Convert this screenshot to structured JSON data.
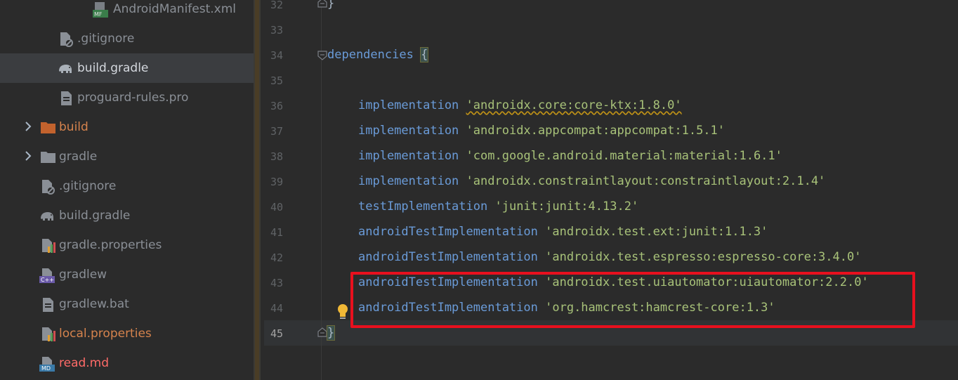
{
  "sidebar": {
    "items": [
      {
        "label": "AndroidManifest.xml",
        "icon": "manifest-file-icon",
        "style": "muted"
      },
      {
        "label": ".gitignore",
        "icon": "gitignore-file-icon",
        "style": "muted"
      },
      {
        "label": "build.gradle",
        "icon": "gradle-elephant-icon",
        "style": "bright",
        "selected": true
      },
      {
        "label": "proguard-rules.pro",
        "icon": "text-file-icon",
        "style": "muted"
      },
      {
        "label": "build",
        "icon": "folder-icon",
        "style": "orange",
        "expandable": true
      },
      {
        "label": "gradle",
        "icon": "folder-icon",
        "style": "muted",
        "expandable": true
      },
      {
        "label": ".gitignore",
        "icon": "gitignore-file-icon",
        "style": "muted"
      },
      {
        "label": "build.gradle",
        "icon": "gradle-elephant-icon",
        "style": "muted"
      },
      {
        "label": "gradle.properties",
        "icon": "properties-file-icon",
        "style": "muted"
      },
      {
        "label": "gradlew",
        "icon": "cpp-file-icon",
        "style": "muted"
      },
      {
        "label": "gradlew.bat",
        "icon": "text-file-icon",
        "style": "muted"
      },
      {
        "label": "local.properties",
        "icon": "properties-file-icon",
        "style": "orange"
      },
      {
        "label": "read.md",
        "icon": "markdown-file-icon",
        "style": "red"
      }
    ]
  },
  "editor": {
    "lines": [
      {
        "num": "32",
        "kw": "",
        "str": "",
        "text": "}"
      },
      {
        "num": "33",
        "kw": "",
        "str": "",
        "text": ""
      },
      {
        "num": "34",
        "kw": "",
        "str": "",
        "text": "dependencies {"
      },
      {
        "num": "35",
        "kw": "",
        "str": "",
        "text": ""
      },
      {
        "num": "36",
        "kw": "implementation",
        "str": "'androidx.core:core-ktx:1.8.0'"
      },
      {
        "num": "37",
        "kw": "implementation",
        "str": "'androidx.appcompat:appcompat:1.5.1'"
      },
      {
        "num": "38",
        "kw": "implementation",
        "str": "'com.google.android.material:material:1.6.1'"
      },
      {
        "num": "39",
        "kw": "implementation",
        "str": "'androidx.constraintlayout:constraintlayout:2.1.4'"
      },
      {
        "num": "40",
        "kw": "testImplementation",
        "str": "'junit:junit:4.13.2'"
      },
      {
        "num": "41",
        "kw": "androidTestImplementation",
        "str": "'androidx.test.ext:junit:1.1.3'"
      },
      {
        "num": "42",
        "kw": "androidTestImplementation",
        "str": "'androidx.test.espresso:espresso-core:3.4.0'"
      },
      {
        "num": "43",
        "kw": "androidTestImplementation",
        "str": "'androidx.test.uiautomator:uiautomator:2.2.0'"
      },
      {
        "num": "44",
        "kw": "androidTestImplementation",
        "str": "'org.hamcrest:hamcrest-core:1.3'"
      },
      {
        "num": "45",
        "kw": "",
        "str": "",
        "text": "}"
      }
    ],
    "dependencies_keyword": "dependencies",
    "open_brace": "{",
    "close_brace": "}"
  },
  "colors": {
    "keyword": "#6a9bd8",
    "string": "#a8c279",
    "highlight_box": "#e8101e",
    "background": "#2b2b2b"
  }
}
